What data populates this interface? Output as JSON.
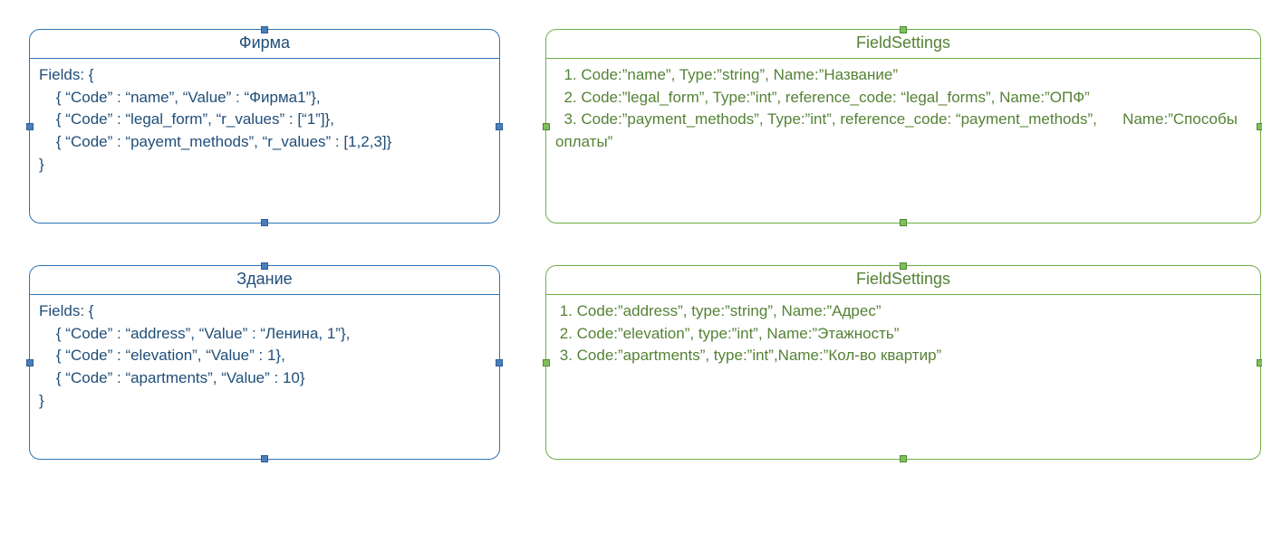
{
  "boxes": {
    "firma": {
      "title": "Фирма",
      "body": "Fields: {\n    { “Code” : “name”, “Value” : “Фирма1”},\n    { “Code” : “legal_form”, “r_values” : [“1”]},\n    { “Code” : “payemt_methods”, “r_values” : [1,2,3]}\n}"
    },
    "fieldsettings1": {
      "title": "FieldSettings",
      "body": "  1. Code:”name”, Type:”string”, Name:”Название”\n  2. Code:”legal_form”, Type:”int”, reference_code: “legal_forms”, Name:”ОПФ”\n  3. Code:”payment_methods”, Type:”int”, reference_code: “payment_methods”,      Name:”Способы оплаты”"
    },
    "zdanie": {
      "title": "Здание",
      "body": "Fields: {\n    { “Code” : “address”, “Value” : “Ленина, 1”},\n    { “Code” : “elevation”, “Value” : 1},\n    { “Code” : “apartments”, “Value” : 10}\n}"
    },
    "fieldsettings2": {
      "title": "FieldSettings",
      "body": " 1. Code:”address”, type:”string”, Name:”Адрес”\n 2. Code:”elevation”, type:”int”, Name:”Этажность”\n 3. Code:”apartments”, type:”int”,Name:”Кол-во квартир”"
    }
  }
}
